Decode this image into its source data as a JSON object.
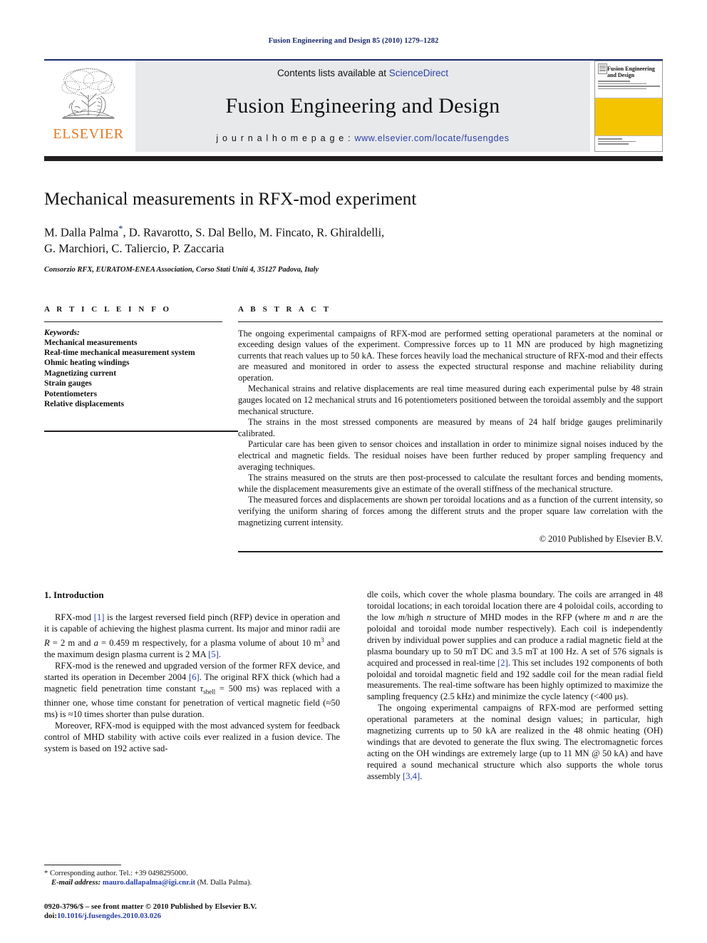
{
  "running_head": "Fusion Engineering and Design 85 (2010) 1279–1282",
  "masthead": {
    "publisher_name": "ELSEVIER",
    "contents_prefix": "Contents lists available at ",
    "contents_link": "ScienceDirect",
    "journal_name": "Fusion Engineering and Design",
    "homepage_label": "j o u r n a l   h o m e p a g e :   ",
    "homepage_url": "www.elsevier.com/locate/fusengdes",
    "cover_title": "Fusion Engineering and Design",
    "accent_orange": "#E87722",
    "accent_blue": "#2b41a6",
    "cover_yellow": "#F5C400",
    "band_grey": "#e8e9eb"
  },
  "article": {
    "title": "Mechanical measurements in RFX-mod experiment",
    "authors": "M. Dalla Palma*, D. Ravarotto, S. Dal Bello, M. Fincato, R. Ghiraldelli, G. Marchiori, C. Taliercio, P. Zaccaria",
    "authors_line_1": "M. Dalla Palma",
    "authors_star": "*",
    "authors_line_1b": ", D. Ravarotto, S. Dal Bello, M. Fincato, R. Ghiraldelli,",
    "authors_line_2": "G. Marchiori, C. Taliercio, P. Zaccaria",
    "affiliation": "Consorzio RFX, EURATOM-ENEA Association, Corso Stati Uniti 4, 35127 Padova, Italy"
  },
  "article_info": {
    "heading": "A R T I C L E   I N F O",
    "keywords_label": "Keywords:",
    "keywords": [
      "Mechanical measurements",
      "Real-time mechanical measurement system",
      "Ohmic heating windings",
      "Magnetizing current",
      "Strain gauges",
      "Potentiometers",
      "Relative displacements"
    ]
  },
  "abstract": {
    "heading": "A B S T R A C T",
    "paragraphs": [
      "The ongoing experimental campaigns of RFX-mod are performed setting operational parameters at the nominal or exceeding design values of the experiment. Compressive forces up to 11 MN are produced by high magnetizing currents that reach values up to 50 kA. These forces heavily load the mechanical structure of RFX-mod and their effects are measured and monitored in order to assess the expected structural response and machine reliability during operation.",
      "Mechanical strains and relative displacements are real time measured during each experimental pulse by 48 strain gauges located on 12 mechanical struts and 16 potentiometers positioned between the toroidal assembly and the support mechanical structure.",
      "The strains in the most stressed components are measured by means of 24 half bridge gauges preliminarily calibrated.",
      "Particular care has been given to sensor choices and installation in order to minimize signal noises induced by the electrical and magnetic fields. The residual noises have been further reduced by proper sampling frequency and averaging techniques.",
      "The strains measured on the struts are then post-processed to calculate the resultant forces and bending moments, while the displacement measurements give an estimate of the overall stiffness of the mechanical structure.",
      "The measured forces and displacements are shown per toroidal locations and as a function of the current intensity, so verifying the uniform sharing of forces among the different struts and the proper square law correlation with the magnetizing current intensity."
    ],
    "copyright": "© 2010 Published by Elsevier B.V."
  },
  "body": {
    "section_number_title": "1.  Introduction",
    "left_paragraphs": [
      "RFX-mod [1] is the largest reversed field pinch (RFP) device in operation and it is capable of achieving the highest plasma current. Its major and minor radii are R = 2 m and a = 0.459 m respectively, for a plasma volume of about 10 m3 and the maximum design plasma current is 2 MA [5].",
      "RFX-mod is the renewed and upgraded version of the former RFX device, and started its operation in December 2004 [6]. The original RFX thick (which had a magnetic field penetration time constant τshell = 500 ms) was replaced with a thinner one, whose time constant for penetration of vertical magnetic field (≈50 ms) is ≈10 times shorter than pulse duration.",
      "Moreover, RFX-mod is equipped with the most advanced system for feedback control of MHD stability with active coils ever realized in a fusion device. The system is based on 192 active sad-"
    ],
    "right_paragraphs": [
      "dle coils, which cover the whole plasma boundary. The coils are arranged in 48 toroidal locations; in each toroidal location there are 4 poloidal coils, according to the low m/high n structure of MHD modes in the RFP (where m and n are the poloidal and toroidal mode number respectively). Each coil is independently driven by individual power supplies and can produce a radial magnetic field at the plasma boundary up to 50 mT DC and 3.5 mT at 100 Hz. A set of 576 signals is acquired and processed in real-time [2]. This set includes 192 components of both poloidal and toroidal magnetic field and 192 saddle coil for the mean radial field measurements. The real-time software has been highly optimized to maximize the sampling frequency (2.5 kHz) and minimize the cycle latency (≤400 μs).",
      "The ongoing experimental campaigns of RFX-mod are performed setting operational parameters at the nominal design values; in particular, high magnetizing currents up to 50 kA are realized in the 48 ohmic heating (OH) windings that are devoted to generate the flux swing. The electromagnetic forces acting on the OH windings are extremely large (up to 11 MN @ 50 kA) and have required a sound mechanical structure which also supports the whole torus assembly [3,4]."
    ]
  },
  "footnote": {
    "corresponding": "* Corresponding author. Tel.: +39 0498295000.",
    "email_label": "E-mail address:",
    "email": "mauro.dallapalma@igi.cnr.it",
    "email_owner": "(M. Dalla Palma)."
  },
  "imprint": {
    "line1": "0920-3796/$ – see front matter © 2010 Published by Elsevier B.V.",
    "doi_prefix": "doi:",
    "doi": "10.1016/j.fusengdes.2010.03.026"
  }
}
